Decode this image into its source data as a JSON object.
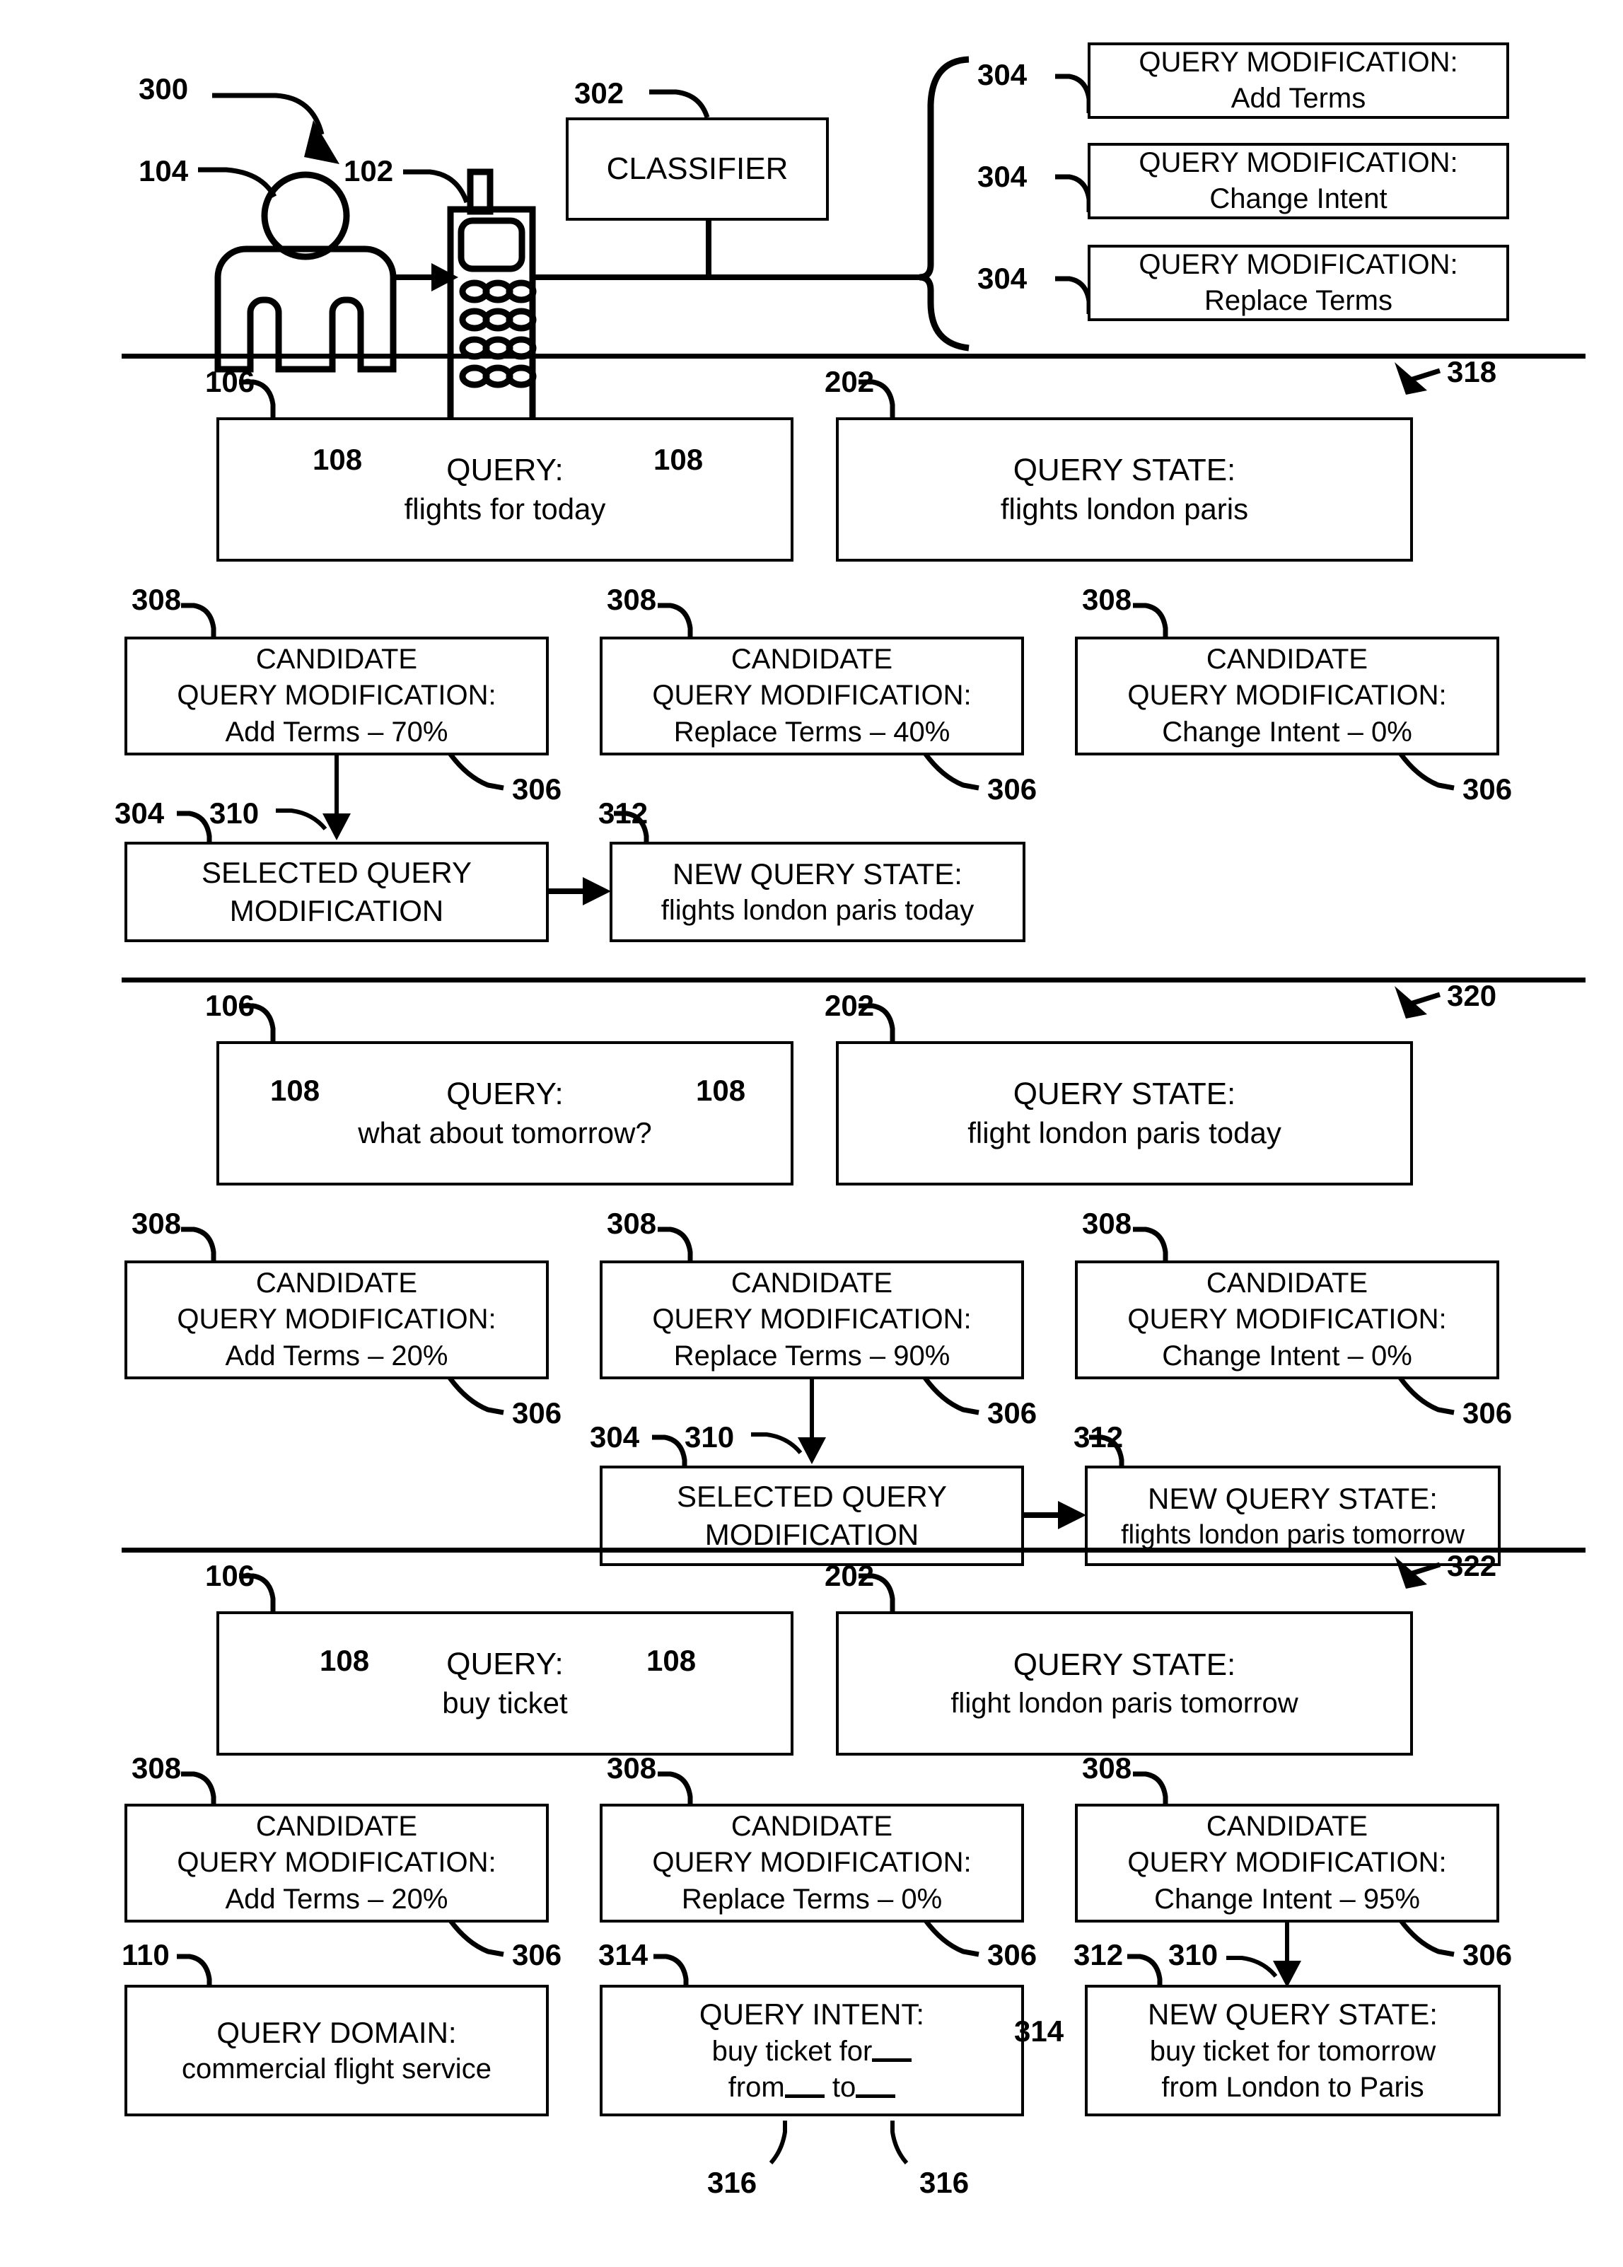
{
  "figure": {
    "ref_system": "300",
    "ref_user": "104",
    "ref_device": "102",
    "ref_classifier": "302",
    "classifier_label": "CLASSIFIER"
  },
  "modification_types": [
    {
      "ref": "304",
      "title": "QUERY MODIFICATION:",
      "value": "Add Terms"
    },
    {
      "ref": "304",
      "title": "QUERY MODIFICATION:",
      "value": "Change Intent"
    },
    {
      "ref": "304",
      "title": "QUERY MODIFICATION:",
      "value": "Replace Terms"
    }
  ],
  "sections": [
    {
      "ref": "318",
      "query": {
        "ref": "106",
        "ref_left": "108",
        "ref_right": "108",
        "title": "QUERY:",
        "value": "flights for today"
      },
      "query_state": {
        "ref": "202",
        "title": "QUERY STATE:",
        "value": "flights london paris"
      },
      "candidates": [
        {
          "ref": "308",
          "ref_score": "306",
          "l1": "CANDIDATE",
          "l2": "QUERY MODIFICATION:",
          "l3": "Add Terms – 70%"
        },
        {
          "ref": "308",
          "ref_score": "306",
          "l1": "CANDIDATE",
          "l2": "QUERY MODIFICATION:",
          "l3": "Replace Terms – 40%"
        },
        {
          "ref": "308",
          "ref_score": "306",
          "l1": "CANDIDATE",
          "l2": "QUERY MODIFICATION:",
          "l3": "Change Intent – 0%"
        }
      ],
      "selected": {
        "ref": "304",
        "ref_arrow": "310",
        "l1": "SELECTED QUERY",
        "l2": "MODIFICATION"
      },
      "new_state": {
        "ref": "312",
        "title": "NEW QUERY STATE:",
        "value": "flights london paris today"
      },
      "selected_from_index": 0
    },
    {
      "ref": "320",
      "query": {
        "ref": "106",
        "ref_left": "108",
        "ref_right": "108",
        "title": "QUERY:",
        "value": "what about tomorrow?"
      },
      "query_state": {
        "ref": "202",
        "title": "QUERY STATE:",
        "value": "flight london paris today"
      },
      "candidates": [
        {
          "ref": "308",
          "ref_score": "306",
          "l1": "CANDIDATE",
          "l2": "QUERY MODIFICATION:",
          "l3": "Add Terms – 20%"
        },
        {
          "ref": "308",
          "ref_score": "306",
          "l1": "CANDIDATE",
          "l2": "QUERY MODIFICATION:",
          "l3": "Replace Terms – 90%"
        },
        {
          "ref": "308",
          "ref_score": "306",
          "l1": "CANDIDATE",
          "l2": "QUERY MODIFICATION:",
          "l3": "Change Intent – 0%"
        }
      ],
      "selected": {
        "ref": "304",
        "ref_arrow": "310",
        "l1": "SELECTED QUERY",
        "l2": "MODIFICATION"
      },
      "new_state": {
        "ref": "312",
        "title": "NEW QUERY STATE:",
        "value": "flights london paris tomorrow"
      },
      "selected_from_index": 1
    },
    {
      "ref": "322",
      "query": {
        "ref": "106",
        "ref_left": "108",
        "ref_right": "108",
        "title": "QUERY:",
        "value": "buy ticket"
      },
      "query_state": {
        "ref": "202",
        "title": "QUERY STATE:",
        "value": "flight london paris tomorrow"
      },
      "candidates": [
        {
          "ref": "308",
          "ref_score": "306",
          "l1": "CANDIDATE",
          "l2": "QUERY MODIFICATION:",
          "l3": "Add Terms – 20%"
        },
        {
          "ref": "308",
          "ref_score": "306",
          "l1": "CANDIDATE",
          "l2": "QUERY MODIFICATION:",
          "l3": "Replace Terms – 0%"
        },
        {
          "ref": "308",
          "ref_score": "306",
          "l1": "CANDIDATE",
          "l2": "QUERY MODIFICATION:",
          "l3": "Change Intent – 95%"
        }
      ],
      "query_domain": {
        "ref": "110",
        "title": "QUERY DOMAIN:",
        "value": "commercial flight service"
      },
      "query_intent": {
        "ref": "314",
        "ref_slot": "314",
        "ref_blank_a": "316",
        "ref_blank_b": "316",
        "title": "QUERY INTENT:",
        "line1": "buy ticket for",
        "line2_pre": "from",
        "line2_mid": "to"
      },
      "new_state": {
        "ref": "312",
        "ref_arrow": "310",
        "title": "NEW QUERY STATE:",
        "line1": "buy ticket for tomorrow",
        "line2": "from London to Paris"
      },
      "selected_from_index": 2
    }
  ]
}
